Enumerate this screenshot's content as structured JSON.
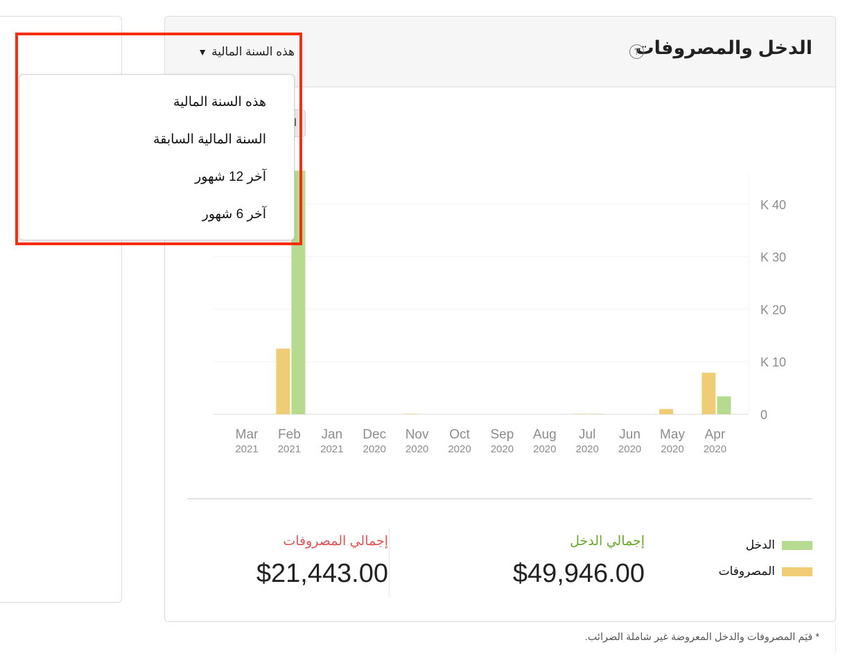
{
  "widget": {
    "title": "الدخل والمصروفات",
    "help_icon": "question-circle-icon",
    "period_selected": "هذه السنة المالية",
    "caret_icon": "triangle-down-icon",
    "hidden_button_text": "ا"
  },
  "dropdown": {
    "options": [
      "هذه السنة المالية",
      "السنة المالية السابقة",
      "آخر 12 شهور",
      "آخر 6 شهور"
    ]
  },
  "legend": {
    "items": [
      {
        "label": "الدخل",
        "color": "#b6db8f"
      },
      {
        "label": "المصروفات",
        "color": "#f0cd74"
      }
    ]
  },
  "totals": {
    "income_label": "إجمالي الدخل",
    "income_value": "$49,946.00",
    "income_color": "#6aa828",
    "expense_label": "إجمالي المصروفات",
    "expense_value": "$21,443.00",
    "expense_color": "#e35353"
  },
  "footnote": "* قيَم المصروفات والدخل المعروضة غير شاملة الضرائب.",
  "colors": {
    "income": "#b6db8f",
    "expense": "#f0cd74",
    "highlight": "#f72e0e"
  },
  "chart_data": {
    "type": "bar",
    "title": "الدخل والمصروفات",
    "xlabel": "",
    "ylabel": "",
    "ylim": [
      0,
      46500
    ],
    "y_ticks": [
      0,
      10000,
      20000,
      30000,
      40000
    ],
    "y_tick_labels": [
      "0",
      "K 10",
      "K 20",
      "K 30",
      "K 40"
    ],
    "grid": true,
    "legend_position": "bottom-right",
    "categories": [
      {
        "month": "Mar",
        "year": "2021"
      },
      {
        "month": "Feb",
        "year": "2021"
      },
      {
        "month": "Jan",
        "year": "2021"
      },
      {
        "month": "Dec",
        "year": "2020"
      },
      {
        "month": "Nov",
        "year": "2020"
      },
      {
        "month": "Oct",
        "year": "2020"
      },
      {
        "month": "Sep",
        "year": "2020"
      },
      {
        "month": "Aug",
        "year": "2020"
      },
      {
        "month": "Jul",
        "year": "2020"
      },
      {
        "month": "Jun",
        "year": "2020"
      },
      {
        "month": "May",
        "year": "2020"
      },
      {
        "month": "Apr",
        "year": "2020"
      }
    ],
    "series": [
      {
        "name": "المصروفات",
        "color": "#f0cd74",
        "values": [
          0,
          12500,
          0,
          0,
          150,
          0,
          0,
          0,
          80,
          0,
          1000,
          7900
        ]
      },
      {
        "name": "الدخل",
        "color": "#b6db8f",
        "values": [
          0,
          46400,
          0,
          0,
          0,
          0,
          0,
          0,
          60,
          0,
          0,
          3400
        ]
      }
    ]
  }
}
